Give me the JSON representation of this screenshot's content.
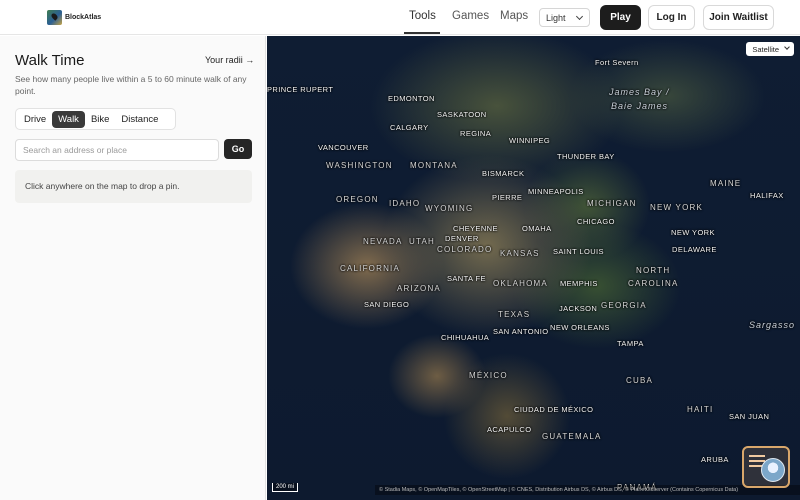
{
  "brand": {
    "name": "BlockAtlas",
    "logo_icon": "map-pin-logo"
  },
  "nav": {
    "tools": "Tools",
    "games": "Games",
    "maps": "Maps",
    "active": "Tools"
  },
  "theme_select": {
    "value": "Light"
  },
  "buttons": {
    "play": "Play",
    "login": "Log In",
    "waitlist": "Join Waitlist",
    "go": "Go"
  },
  "panel": {
    "title": "Walk Time",
    "radii_link": "Your radii →",
    "description": "See how many people live within a 5 to 60 minute walk of any point.",
    "modes": [
      "Drive",
      "Walk",
      "Bike",
      "Distance"
    ],
    "active_mode": "Walk",
    "search_placeholder": "Search an address or place",
    "hint": "Click anywhere on the map to drop a pin."
  },
  "map": {
    "layer_toggle": "Satellite",
    "scale": "200 mi",
    "attribution": "© Stadia Maps, © OpenMapTiles, © OpenStreetMap | © CNES, Distribution Airbus DS, © Airbus DS, © PlanetObserver (Contains Copernicus Data)",
    "labels": {
      "fort_severn": "Fort Severn",
      "james_bay": "James Bay /",
      "baie_james": "Baie James",
      "prince_rupert": "PRINCE RUPERT",
      "edmonton": "EDMONTON",
      "saskatoon": "SASKATOON",
      "calgary": "CALGARY",
      "regina": "REGINA",
      "winnipeg": "WINNIPEG",
      "vancouver": "VANCOUVER",
      "washington": "WASHINGTON",
      "montana": "MONTANA",
      "thunder_bay": "THUNDER BAY",
      "bismarck": "BISMARCK",
      "maine": "MAINE",
      "minneapolis": "MINNEAPOLIS",
      "halifax": "HALIFAX",
      "oregon": "OREGON",
      "idaho": "IDAHO",
      "wyoming": "WYOMING",
      "pierre": "PIERRE",
      "michigan": "MICHIGAN",
      "new_york_state": "NEW YORK",
      "chicago": "CHICAGO",
      "cheyenne": "CHEYENNE",
      "omaha": "OMAHA",
      "new_york": "NEW YORK",
      "nevada": "NEVADA",
      "utah": "UTAH",
      "denver": "DENVER",
      "colorado": "COLORADO",
      "saint_louis": "SAINT LOUIS",
      "kansas": "KANSAS",
      "delaware": "DELAWARE",
      "california": "CALIFORNIA",
      "north": "NORTH",
      "santa_fe": "SANTA FE",
      "memphis": "MEMPHIS",
      "carolina": "CAROLINA",
      "arizona": "ARIZONA",
      "oklahoma": "OKLAHOMA",
      "san_diego": "SAN DIEGO",
      "jackson": "JACKSON",
      "georgia": "GEORGIA",
      "texas": "TEXAS",
      "sargasso": "Sargasso",
      "san_antonio": "SAN ANTONIO",
      "new_orleans": "NEW ORLEANS",
      "chihuahua": "CHIHUAHUA",
      "tampa": "TAMPA",
      "mexico": "MÉXICO",
      "cuba": "CUBA",
      "haiti": "HAITI",
      "ciudad_de_mexico": "CIUDAD DE MÉXICO",
      "san_juan": "SAN JUAN",
      "acapulco": "ACAPULCO",
      "guatemala": "GUATEMALA",
      "aruba": "ARUBA",
      "panama": "PANAMÁ"
    }
  }
}
